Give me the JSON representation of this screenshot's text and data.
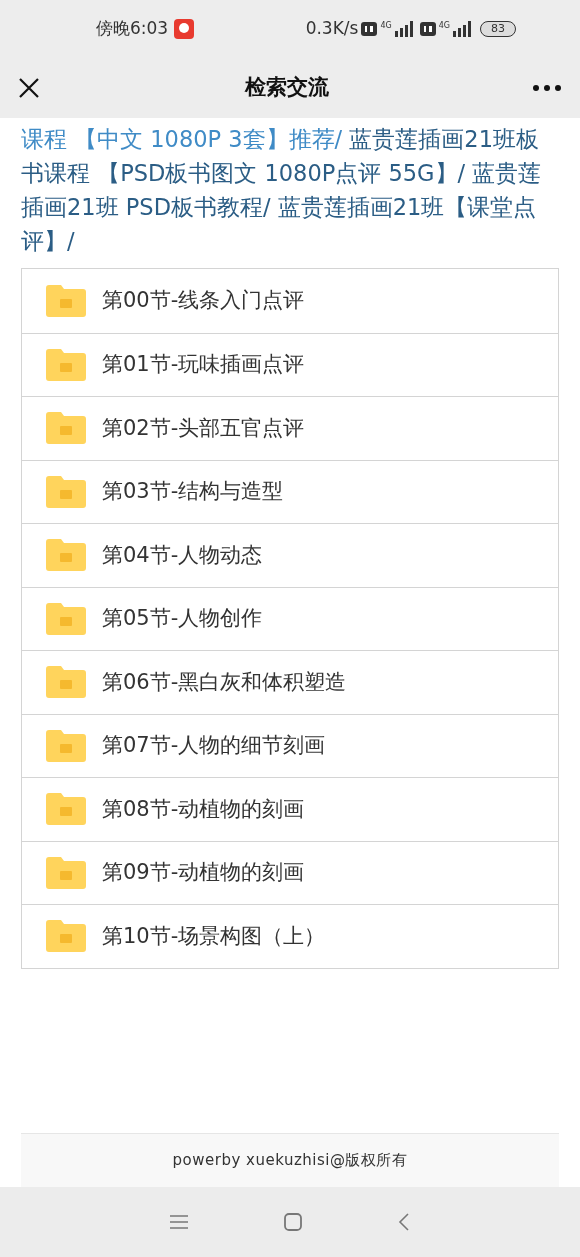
{
  "status_bar": {
    "time": "傍晚6:03",
    "speed": "0.3K/s",
    "network_1": "4G",
    "network_2": "4G",
    "battery": "83"
  },
  "header": {
    "title": "检索交流"
  },
  "breadcrumb": [
    {
      "text": "课程 【中文 1080P 3套】推荐/",
      "color": "#3f8bc6"
    },
    {
      "text": " 蓝贵莲插画21班板书课程 【PSD板书图文 1080P点评 55G】/",
      "color": "#2b5d85"
    },
    {
      "text": " 蓝贵莲插画21班 PSD板书教程/",
      "color": "#2b5d85"
    },
    {
      "text": " 蓝贵莲插画21班【课堂点评】/",
      "color": "#2b5d85"
    }
  ],
  "folders": [
    {
      "name": "第00节-线条入门点评"
    },
    {
      "name": "第01节-玩味插画点评"
    },
    {
      "name": "第02节-头部五官点评"
    },
    {
      "name": "第03节-结构与造型"
    },
    {
      "name": "第04节-人物动态"
    },
    {
      "name": "第05节-人物创作"
    },
    {
      "name": "第06节-黑白灰和体积塑造"
    },
    {
      "name": "第07节-人物的细节刻画"
    },
    {
      "name": "第08节-动植物的刻画"
    },
    {
      "name": "第09节-动植物的刻画"
    },
    {
      "name": "第10节-场景构图（上）"
    }
  ],
  "footer": {
    "text": "powerby xuekuzhisi@版权所有"
  }
}
